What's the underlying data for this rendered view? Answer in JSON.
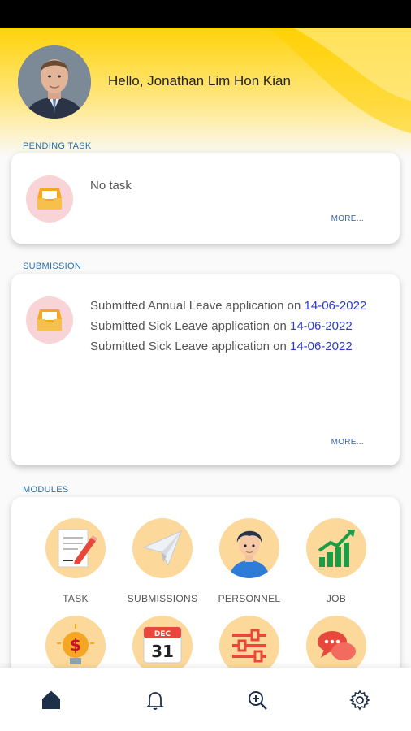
{
  "user": {
    "greeting": "Hello, Jonathan Lim Hon Kian"
  },
  "pending": {
    "section_label": "PENDING TASK",
    "empty_text": "No task",
    "more_label": "MORE..."
  },
  "submission": {
    "section_label": "SUBMISSION",
    "items": [
      {
        "text": "Submitted Annual Leave application on ",
        "date": "14-06-2022"
      },
      {
        "text": "Submitted Sick Leave application on ",
        "date": "14-06-2022"
      },
      {
        "text": "Submitted Sick Leave application on ",
        "date": "14-06-2022"
      }
    ],
    "more_label": "MORE..."
  },
  "modules": {
    "section_label": "MODULES",
    "items": [
      {
        "label": "TASK",
        "icon": "task-icon"
      },
      {
        "label": "SUBMISSIONS",
        "icon": "paper-plane-icon"
      },
      {
        "label": "PERSONNEL",
        "icon": "person-icon"
      },
      {
        "label": "JOB",
        "icon": "growth-chart-icon"
      },
      {
        "label": "",
        "icon": "idea-bulb-icon"
      },
      {
        "label": "",
        "icon": "calendar-icon",
        "calendar_month": "DEC",
        "calendar_day": "31"
      },
      {
        "label": "",
        "icon": "sliders-icon"
      },
      {
        "label": "",
        "icon": "chat-bubbles-icon"
      }
    ]
  },
  "nav": [
    {
      "icon": "home-icon"
    },
    {
      "icon": "bell-icon"
    },
    {
      "icon": "zoom-in-icon"
    },
    {
      "icon": "gear-icon"
    }
  ],
  "colors": {
    "accent_yellow": "#ffd30a",
    "link_blue": "#2b3cc9",
    "section_blue": "#2a6fa8",
    "module_circle": "#fcd99b",
    "inbox_circle": "#f8d4d6"
  }
}
